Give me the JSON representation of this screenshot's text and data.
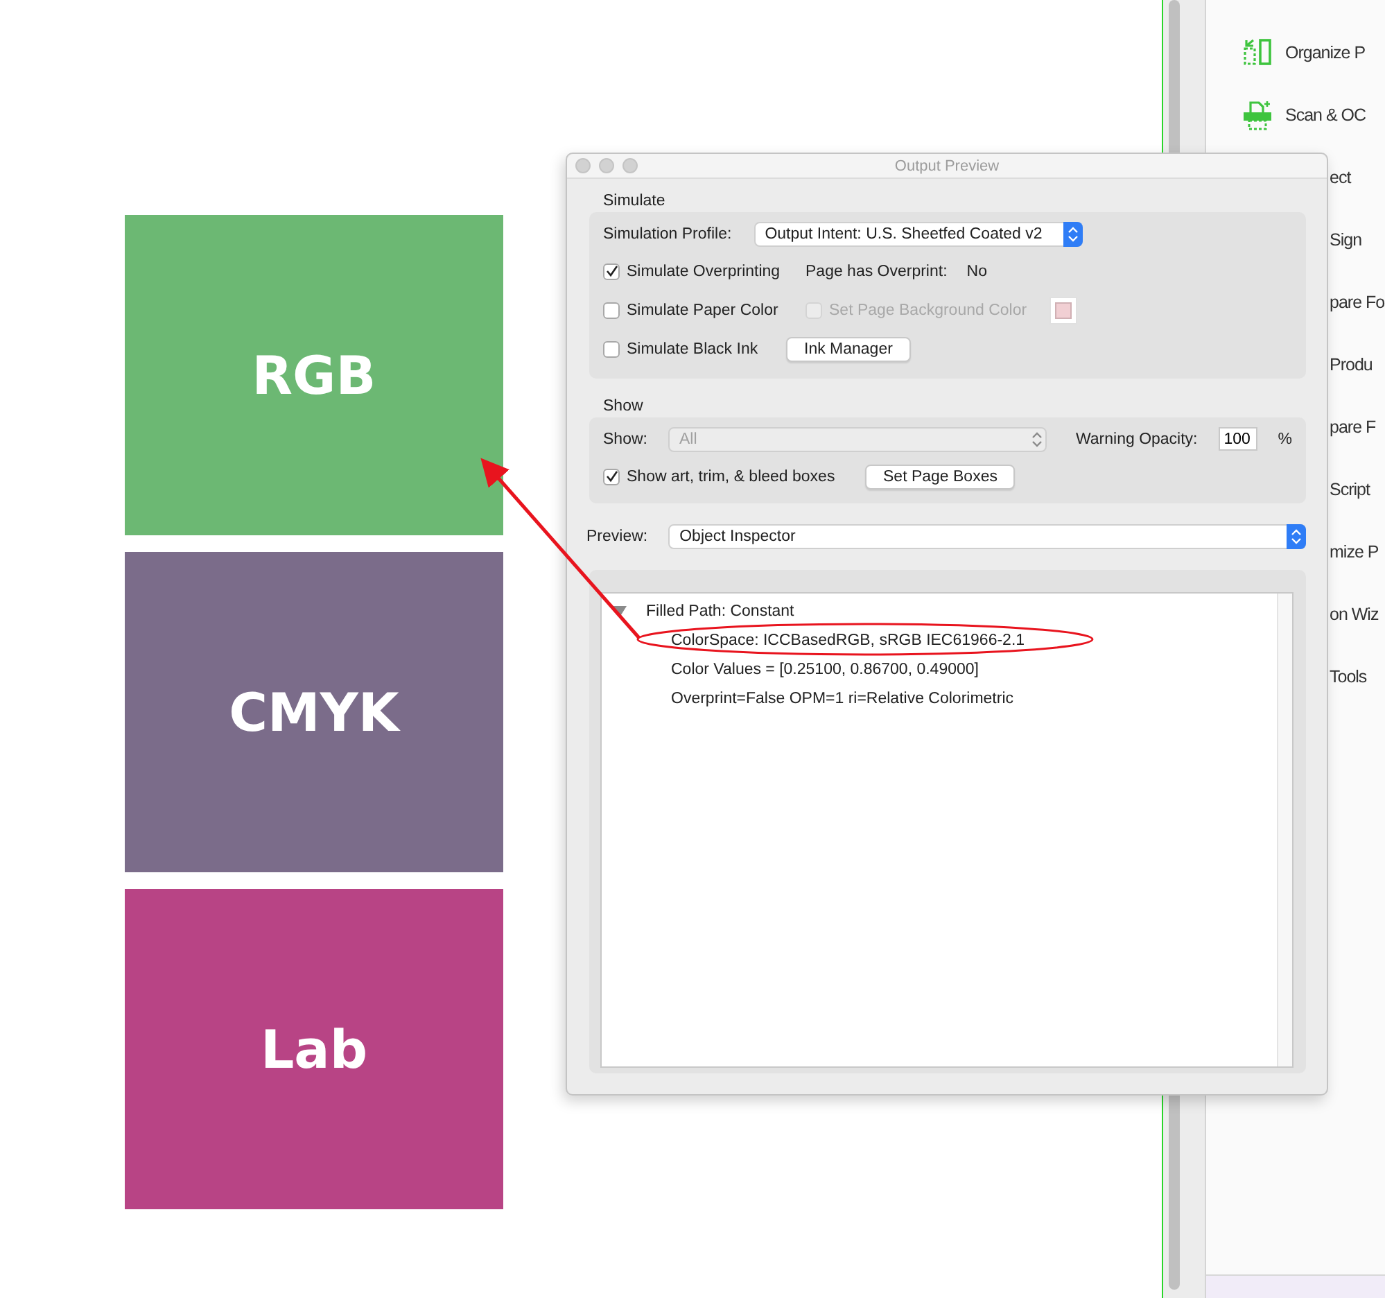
{
  "canvas": {
    "swatches": [
      {
        "label": "RGB",
        "color": "#6cb873"
      },
      {
        "label": "CMYK",
        "color": "#7b6c8a"
      },
      {
        "label": "Lab",
        "color": "#b84485"
      }
    ]
  },
  "tools_pane": {
    "items": [
      {
        "kind": "organize",
        "label": "Organize P"
      },
      {
        "kind": "scan",
        "label": "Scan & OC"
      },
      {
        "kind": "covered",
        "label": "ect"
      },
      {
        "kind": "covered",
        "label": "Sign"
      },
      {
        "kind": "covered",
        "label": "pare Fo"
      },
      {
        "kind": "covered",
        "label": "Produ"
      },
      {
        "kind": "covered",
        "label": "pare F"
      },
      {
        "kind": "covered",
        "label": "Script"
      },
      {
        "kind": "covered",
        "label": "mize P"
      },
      {
        "kind": "covered",
        "label": "on Wiz"
      },
      {
        "kind": "covered",
        "label": "Tools"
      }
    ]
  },
  "dialog": {
    "title": "Output Preview",
    "simulate": {
      "heading": "Simulate",
      "profile": {
        "label": "Simulation Profile:",
        "value": "Output Intent: U.S. Sheetfed Coated v2",
        "disabled": false
      },
      "overprinting": {
        "label": "Simulate Overprinting",
        "checked": true,
        "disabled": false
      },
      "page_overprint": {
        "label": "Page has Overprint:",
        "value": "No"
      },
      "paper_color": {
        "label": "Simulate Paper Color",
        "checked": false,
        "disabled": false
      },
      "page_background": {
        "label": "Set Page Background Color",
        "checked": false,
        "disabled": true,
        "color": "#f1cfd3"
      },
      "black_ink": {
        "label": "Simulate Black Ink",
        "checked": false,
        "disabled": false
      },
      "ink_manager": {
        "label": "Ink Manager"
      }
    },
    "show": {
      "heading": "Show",
      "show_select": {
        "label": "Show:",
        "value": "All",
        "disabled": true
      },
      "warning_opacity": {
        "label": "Warning Opacity:",
        "value": "100",
        "unit": "%"
      },
      "boxes": {
        "label": "Show art, trim, & bleed boxes",
        "checked": true,
        "disabled": false
      },
      "page_boxes": {
        "label": "Set Page Boxes"
      }
    },
    "preview": {
      "label": "Preview:",
      "value": "Object Inspector",
      "disabled": false
    },
    "inspector": {
      "items": [
        {
          "label": "Filled Path: Constant",
          "expanded": true,
          "children": [
            {
              "label": "ColorSpace: ICCBasedRGB, sRGB IEC61966-2.1"
            },
            {
              "label": "Color Values = [0.25100, 0.86700, 0.49000]"
            },
            {
              "label": "Overprint=False OPM=1 ri=Relative Colorimetric"
            }
          ]
        }
      ]
    }
  }
}
